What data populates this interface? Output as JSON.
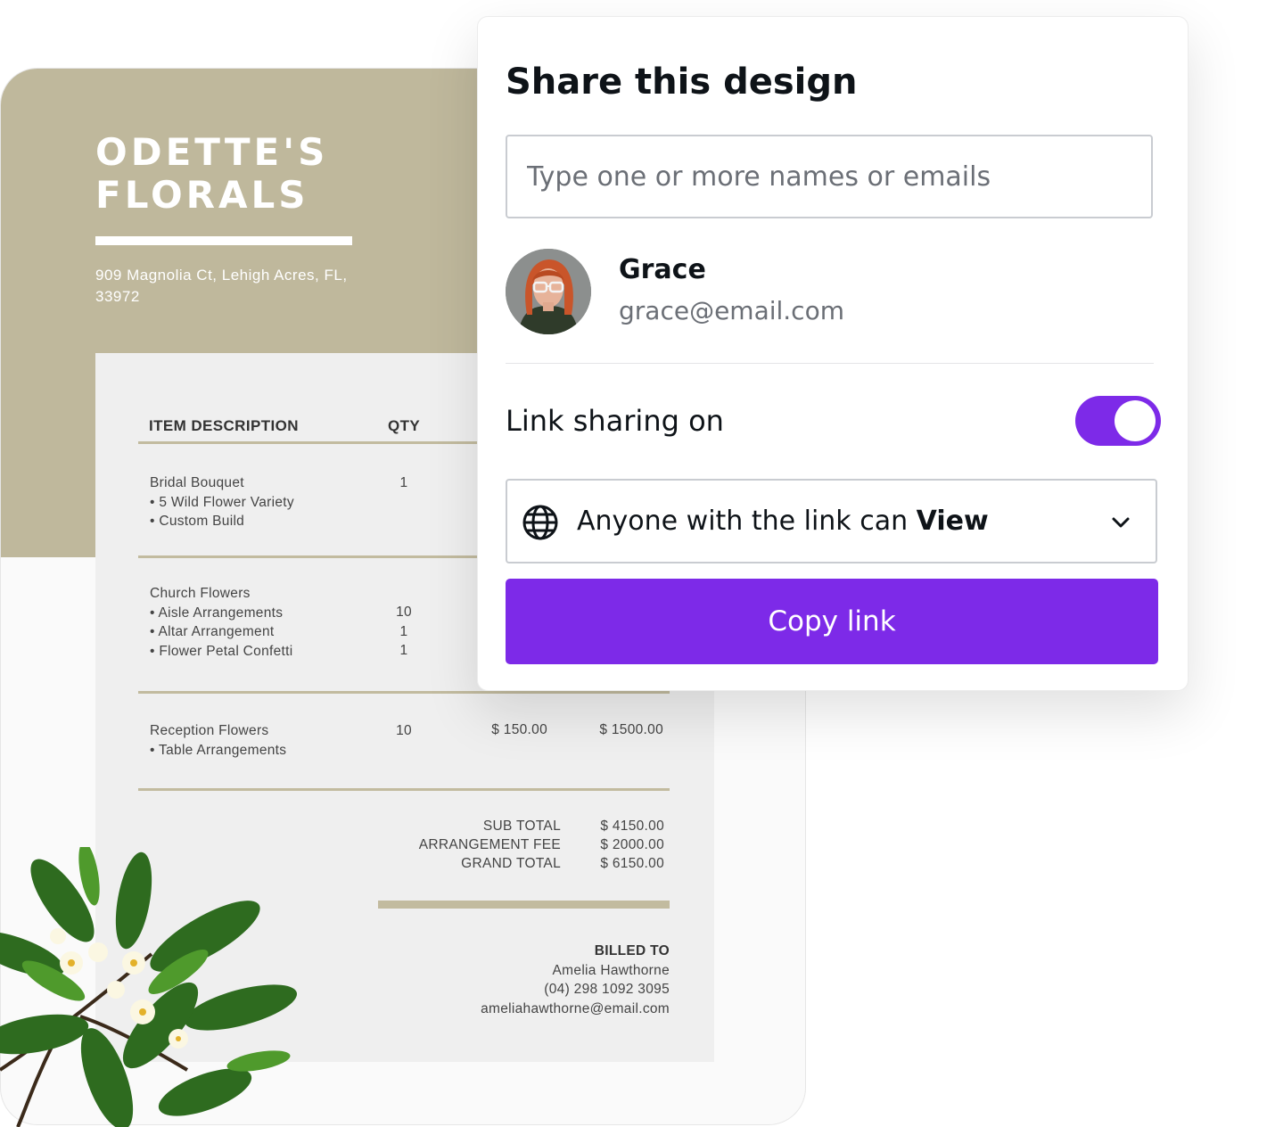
{
  "invoice": {
    "brand_line1": "ODETTE'S",
    "brand_line2": "FLORALS",
    "address": "909 Magnolia Ct, Lehigh Acres, FL, 33972",
    "headers": {
      "item": "ITEM DESCRIPTION",
      "qty": "QTY"
    },
    "rows": [
      {
        "lines": [
          "Bridal Bouquet",
          "• 5 Wild Flower Variety",
          "• Custom Build"
        ],
        "qty": [
          "1"
        ],
        "price": "",
        "total": ""
      },
      {
        "lines": [
          "Church Flowers",
          "• Aisle Arrangements",
          "• Altar Arrangement",
          "• Flower Petal Confetti"
        ],
        "qty": [
          "10",
          "1",
          "1"
        ],
        "price": "",
        "total": ""
      },
      {
        "lines": [
          "Reception Flowers",
          "• Table Arrangements"
        ],
        "qty": [
          "10"
        ],
        "price": "$ 150.00",
        "total": "$ 1500.00"
      }
    ],
    "totals": {
      "sub_total_label": "SUB TOTAL",
      "sub_total": "$ 4150.00",
      "fee_label": "ARRANGEMENT FEE",
      "fee": "$ 2000.00",
      "grand_total_label": "GRAND TOTAL",
      "grand_total": "$ 6150.00"
    },
    "billed_to": {
      "label": "BILLED TO",
      "name": "Amelia Hawthorne",
      "phone": "(04) 298 1092 3095",
      "email": "ameliahawthorne@email.com"
    }
  },
  "share": {
    "title": "Share this design",
    "invite_placeholder": "Type one or more names or emails",
    "user": {
      "name": "Grace",
      "email": "grace@email.com"
    },
    "link_sharing_label": "Link sharing on",
    "link_sharing_on": true,
    "access_prefix": "Anyone with the link can ",
    "access_level": "View",
    "copy_button": "Copy link",
    "colors": {
      "accent": "#7d2ae8",
      "card": "#bfb89c"
    },
    "icons": {
      "access": "globe-icon",
      "dropdown": "chevron-down-icon"
    }
  }
}
